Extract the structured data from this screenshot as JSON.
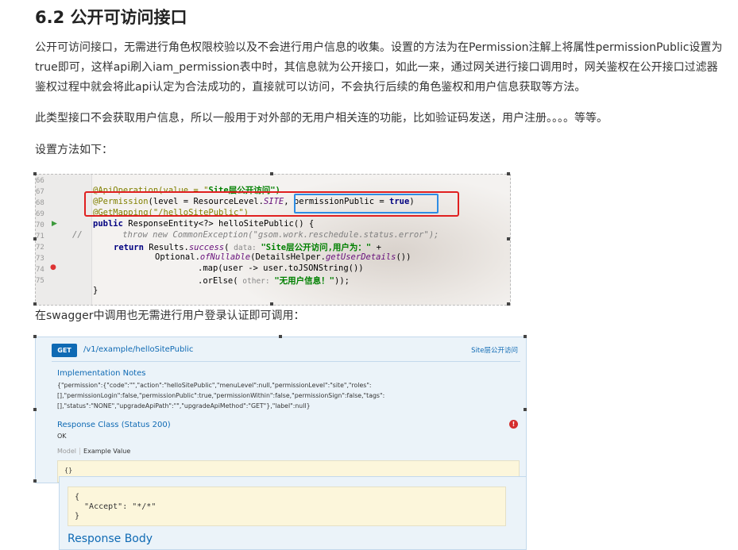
{
  "heading": "6.2 公开可访问接口",
  "para1": "公开可访问接口，无需进行角色权限校验以及不会进行用户信息的收集。设置的方法为在Permission注解上将属性permissionPublic设置为true即可，这样api刷入iam_permission表中时，其信息就为公开接口，如此一来，通过网关进行接口调用时，网关鉴权在公开接口过滤器鉴权过程中就会将此api认定为合法成功的，直接就可以访问，不会执行后续的角色鉴权和用户信息获取等方法。",
  "para2": "此类型接口不会获取用户信息，所以一般用于对外部的无用户相关连的功能，比如验证码发送，用户注册。。。。等等。",
  "para3": "设置方法如下：",
  "para4": "在swagger中调用也无需进行用户登录认证即可调用：",
  "code": {
    "line_numbers": [
      "66",
      "67",
      "68",
      "69",
      "70",
      "71",
      "72",
      "73",
      "74",
      "75"
    ],
    "l66_a": "@ApiOperation(value = \"",
    "l66_b": "Site层公开访问\")",
    "l67_a": "@Permission",
    "l67_b": "(level = ResourceLevel.",
    "l67_c": "SITE",
    "l67_d": ", permissionPublic = ",
    "l67_e": "true",
    "l67_f": ")",
    "l68": "@GetMapping(\"/helloSitePublic\")",
    "l69_a": "public",
    "l69_b": " ResponseEntity<?> helloSitePublic() {",
    "l70": "//        throw new CommonException(\"gsom.work.reschedule.status.error\");",
    "l71_a": "return",
    "l71_b": " Results.",
    "l71_c": "success",
    "l71_d": "(",
    "l71_e": " data: ",
    "l71_f": "\"Site层公开访问,用户为：\"",
    "l71_g": " +",
    "l72_a": "Optional.",
    "l72_b": "ofNullable",
    "l72_c": "(DetailsHelper.",
    "l72_d": "getUserDetails",
    "l72_e": "())",
    "l73": ".map(user -> user.toJSONString())",
    "l74_a": ".orElse(",
    "l74_b": " other: ",
    "l74_c": "\"无用户信息！\"",
    "l74_d": "));",
    "l75": "}"
  },
  "swagger": {
    "method": "GET",
    "path": "/v1/example/helloSitePublic",
    "summary": "Site层公开访问",
    "impl_title": "Implementation Notes",
    "impl_json_1": "{\"permission\":{\"code\":\"\",\"action\":\"helloSitePublic\",\"menuLevel\":null,\"permissionLevel\":\"site\",\"roles\":",
    "impl_json_2": "[],\"permissionLogin\":false,\"permissionPublic\":true,\"permissionWithin\":false,\"permissionSign\":false,\"tags\":",
    "impl_json_3": "[],\"status\":\"NONE\",\"upgradeApiPath\":\"\",\"upgradeApiMethod\":\"GET\"},\"label\":null}",
    "response_class": "Response Class (Status 200)",
    "ok": "OK",
    "tab_model": "Model",
    "tab_example": "Example Value",
    "example_value": "{}",
    "error_icon": "!"
  },
  "lower": {
    "header_json": "{\n  \"Accept\": \"*/*\"\n}",
    "response_body": "Response Body"
  }
}
